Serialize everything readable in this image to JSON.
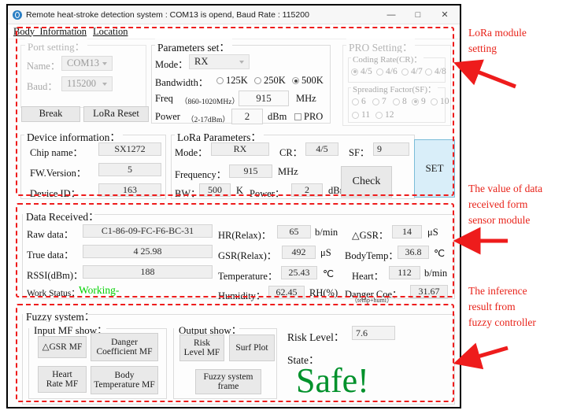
{
  "window": {
    "title": "Remote heat-stroke detection system  :  COM13 is opend, Baud Rate : 115200",
    "minimize": "—",
    "maximize": "□",
    "close": "✕"
  },
  "menu": {
    "items": [
      "Body_Information",
      "Location"
    ]
  },
  "port_setting": {
    "title": "Port setting：",
    "name_label": "Name：",
    "name_value": "COM13",
    "baud_label": "Baud：",
    "baud_value": "115200",
    "break_button": "Break",
    "lora_reset_button": "LoRa Reset"
  },
  "parameters_set": {
    "title": "Parameters set：",
    "mode_label": "Mode：",
    "mode_value": "RX",
    "bandwidth_label": "Bandwidth：",
    "bandwidth_options": [
      "125K",
      "250K",
      "500K"
    ],
    "bandwidth_selected": "500K",
    "freq_label": "Freq",
    "freq_range": "（860-1020MHz）",
    "freq_value": "915",
    "freq_unit": "MHz",
    "power_label": "Power",
    "power_range": "（2-17dBm）",
    "power_value": "2",
    "power_unit": "dBm",
    "pro_checkbox_label": "PRO"
  },
  "pro_setting": {
    "title": "PRO Setting：",
    "cr_title": "Coding Rate(CR)：",
    "cr_options": [
      "4/5",
      "4/6",
      "4/7",
      "4/8"
    ],
    "cr_selected": "4/5",
    "sf_title": "Spreading Factor(SF)：",
    "sf_options_row1": [
      "6",
      "7",
      "8",
      "9",
      "10"
    ],
    "sf_options_row2": [
      "11",
      "12"
    ],
    "sf_selected": "9"
  },
  "device_information": {
    "title": "Device information：",
    "chip_name_label": "Chip name：",
    "chip_name_value": "SX1272",
    "fw_version_label": "FW.Version：",
    "fw_version_value": "5",
    "device_id_label": "Device ID：",
    "device_id_value": "163"
  },
  "lora_parameters": {
    "title": "LoRa Parameters：",
    "mode_label": "Mode：",
    "mode_value": "RX",
    "cr_label": "CR：",
    "cr_value": "4/5",
    "sf_label": "SF：",
    "sf_value": "9",
    "frequency_label": "Frequency：",
    "frequency_value": "915",
    "frequency_unit": "MHz",
    "bw_label": "BW：",
    "bw_value": "500",
    "bw_unit": "K",
    "power_label": "Power：",
    "power_value": "2",
    "power_unit": "dBm",
    "check_button": "Check",
    "set_button": "SET"
  },
  "data_received": {
    "title": "Data Received：",
    "raw_data_label": "Raw data：",
    "raw_data_value": "C1-86-09-FC-F6-BC-31",
    "true_data_label": "True data：",
    "true_data_value": "4 25.98",
    "rssi_label": "RSSI(dBm)：",
    "rssi_value": "188",
    "work_status_label": "Work Status：",
    "work_status_value": "Working-",
    "work_status_color": "#00d200",
    "hr_relax_label": "HR(Relax)：",
    "hr_relax_value": "65",
    "hr_relax_unit": "b/min",
    "gsr_relax_label": "GSR(Relax)：",
    "gsr_relax_value": "492",
    "gsr_relax_unit": "μS",
    "temperature_label": "Temperature：",
    "temperature_value": "25.43",
    "temperature_unit": "℃",
    "humidity_label": "Humidity：",
    "humidity_value": "62.45",
    "humidity_unit": "RH(%)",
    "delta_gsr_label": "△GSR：",
    "delta_gsr_value": "14",
    "delta_gsr_unit": "μS",
    "body_temp_label": "BodyTemp：",
    "body_temp_value": "36.8",
    "body_temp_unit": "℃",
    "heart_label": "Heart：",
    "heart_value": "112",
    "heart_unit": "b/min",
    "danger_coe_label": "Danger Coe：",
    "danger_coe_sub": "（temp+humi）",
    "danger_coe_value": "31.67"
  },
  "fuzzy_system": {
    "title": "Fuzzy system：",
    "input_mf_title": "Input MF show：",
    "input_buttons": [
      "△GSR MF",
      "Danger\nCoefficient MF",
      "Heart\nRate MF",
      "Body\nTemperature MF"
    ],
    "output_title": "Output show：",
    "output_buttons": [
      "Risk\nLevel MF",
      "Surf Plot",
      "Fuzzy system\nframe"
    ],
    "risk_level_label": "Risk Level：",
    "risk_level_value": "7.6",
    "state_label": "State：",
    "state_value": "Safe!",
    "state_color": "#00912b"
  },
  "annotations": {
    "one": "LoRa  module\nsetting",
    "two": "The value of data\nreceived form\nsensor module",
    "three": "The inference\nresult from\nfuzzy controller",
    "color": "#ee1c1c"
  }
}
